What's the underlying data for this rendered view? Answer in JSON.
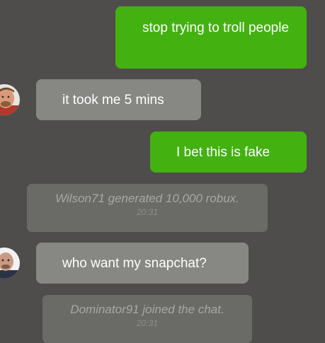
{
  "messages": {
    "m1": {
      "text": "stop trying to troll people",
      "sender": "me"
    },
    "m2": {
      "text": "it took me 5 mins",
      "sender": "other",
      "avatar": "man-red-shirt-avatar"
    },
    "m3": {
      "text": "I bet this is fake",
      "sender": "me"
    },
    "s1": {
      "text": "Wilson71 generated 10,000 robux.",
      "time": "20:31"
    },
    "m4": {
      "text": "who want my snapchat?",
      "sender": "other",
      "avatar": "man-bald-avatar"
    },
    "s2": {
      "text": "Dominator91 joined the chat.",
      "time": "20:31"
    }
  },
  "colors": {
    "background": "#4e4d4b",
    "outgoing_bubble": "#43b110",
    "incoming_bubble": "#878883",
    "system_bubble": "#6a6a67"
  }
}
